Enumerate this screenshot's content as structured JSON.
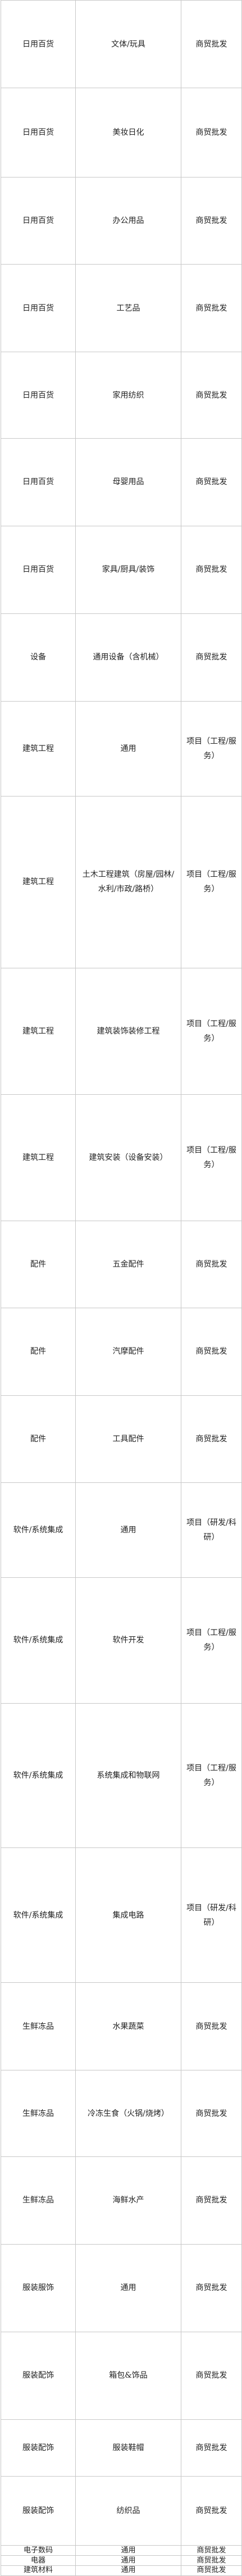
{
  "rows": [
    {
      "category": "日用百货",
      "item": "文体/玩具",
      "type": "商贸批发"
    },
    {
      "category": "日用百货",
      "item": "美妆日化",
      "type": "商贸批发"
    },
    {
      "category": "日用百货",
      "item": "办公用品",
      "type": "商贸批发"
    },
    {
      "category": "日用百货",
      "item": "工艺品",
      "type": "商贸批发"
    },
    {
      "category": "日用百货",
      "item": "家用纺织",
      "type": "商贸批发"
    },
    {
      "category": "日用百货",
      "item": "母婴用品",
      "type": "商贸批发"
    },
    {
      "category": "日用百货",
      "item": "家具/厨具/装饰",
      "type": "商贸批发"
    },
    {
      "category": "设备",
      "item": "通用设备（含机械）",
      "type": "商贸批发"
    },
    {
      "category": "建筑工程",
      "item": "通用",
      "type": "项目（工程/服务）"
    },
    {
      "category": "建筑工程",
      "item": "土木工程建筑（房屋/园林/水利/市政/路桥）",
      "type": "项目（工程/服务）"
    },
    {
      "category": "建筑工程",
      "item": "建筑装饰装修工程",
      "type": "项目（工程/服务）"
    },
    {
      "category": "建筑工程",
      "item": "建筑安装（设备安装）",
      "type": "项目（工程/服务）"
    },
    {
      "category": "配件",
      "item": "五金配件",
      "type": "商贸批发"
    },
    {
      "category": "配件",
      "item": "汽摩配件",
      "type": "商贸批发"
    },
    {
      "category": "配件",
      "item": "工具配件",
      "type": "商贸批发"
    },
    {
      "category": "软件/系统集成",
      "item": "通用",
      "type": "项目（研发/科研）"
    },
    {
      "category": "软件/系统集成",
      "item": "软件开发",
      "type": "项目（工程/服务）"
    },
    {
      "category": "软件/系统集成",
      "item": "系统集成和物联网",
      "type": "项目（工程/服务）"
    },
    {
      "category": "软件/系统集成",
      "item": "集成电路",
      "type": "项目（研发/科研）"
    },
    {
      "category": "生鲜冻品",
      "item": "水果蔬菜",
      "type": "商贸批发"
    },
    {
      "category": "生鲜冻品",
      "item": "冷冻生食（火锅/烧烤）",
      "type": "商贸批发"
    },
    {
      "category": "生鲜冻品",
      "item": "海鲜水产",
      "type": "商贸批发"
    },
    {
      "category": "服装服饰",
      "item": "通用",
      "type": "商贸批发"
    },
    {
      "category": "服装配饰",
      "item": "箱包&饰品",
      "type": "商贸批发"
    },
    {
      "category": "服装配饰",
      "item": "服装鞋帽",
      "type": "商贸批发"
    },
    {
      "category": "服装配饰",
      "item": "纺织品",
      "type": "商贸批发"
    },
    {
      "category": "电子数码",
      "item": "通用",
      "type": "商贸批发"
    },
    {
      "category": "电器",
      "item": "通用",
      "type": "商贸批发"
    },
    {
      "category": "建筑材料",
      "item": "通用",
      "type": "商贸批发"
    }
  ]
}
